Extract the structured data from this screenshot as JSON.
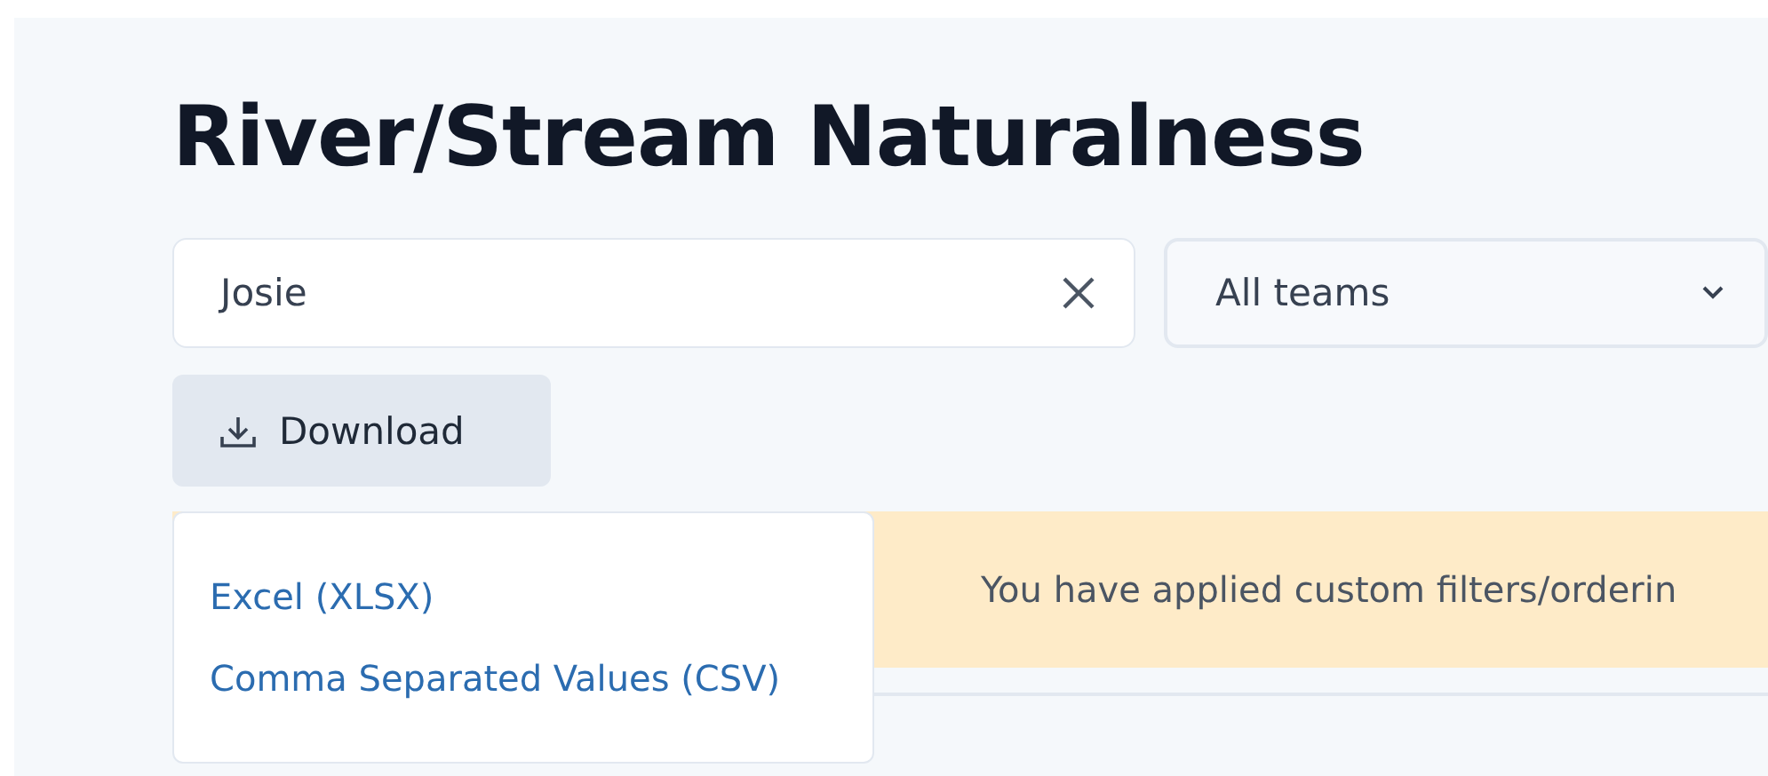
{
  "title": "River/Stream Naturalness",
  "search": {
    "value": "Josie"
  },
  "team_select": {
    "value": "All teams"
  },
  "download_button": {
    "label": "Download"
  },
  "download_menu": {
    "items": [
      {
        "label": "Excel (XLSX)"
      },
      {
        "label": "Comma Separated Values (CSV)"
      }
    ]
  },
  "notice": {
    "text": "You have applied custom filters/orderin"
  }
}
